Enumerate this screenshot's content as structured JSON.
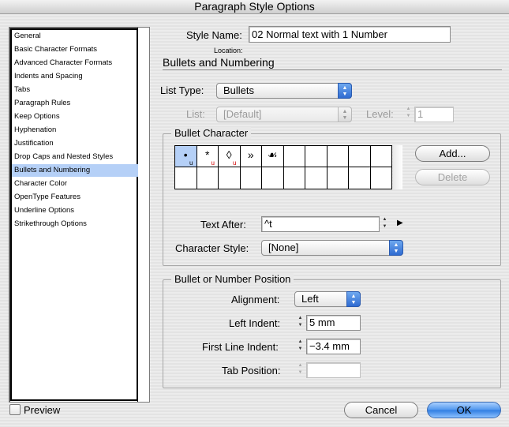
{
  "window": {
    "title": "Paragraph Style Options"
  },
  "sidebar": {
    "items": [
      {
        "label": "General"
      },
      {
        "label": "Basic Character Formats"
      },
      {
        "label": "Advanced Character Formats"
      },
      {
        "label": "Indents and Spacing"
      },
      {
        "label": "Tabs"
      },
      {
        "label": "Paragraph Rules"
      },
      {
        "label": "Keep Options"
      },
      {
        "label": "Hyphenation"
      },
      {
        "label": "Justification"
      },
      {
        "label": "Drop Caps and Nested Styles"
      },
      {
        "label": "Bullets and Numbering"
      },
      {
        "label": "Character Color"
      },
      {
        "label": "OpenType Features"
      },
      {
        "label": "Underline Options"
      },
      {
        "label": "Strikethrough Options"
      }
    ],
    "selected": "Bullets and Numbering"
  },
  "header": {
    "style_name_label": "Style Name:",
    "style_name_value": "02 Normal text with 1 Number",
    "location_label": "Location:",
    "section_title": "Bullets and Numbering"
  },
  "list": {
    "type_label": "List Type:",
    "type_value": "Bullets",
    "list_label": "List:",
    "list_value": "[Default]",
    "level_label": "Level:",
    "level_value": "1"
  },
  "bullet_character": {
    "group_title": "Bullet Character",
    "glyphs": [
      "•",
      "*",
      "◊",
      "»",
      "☙"
    ],
    "glyph_font_marks": [
      "u",
      "u",
      "u",
      "",
      ""
    ],
    "add_label": "Add...",
    "delete_label": "Delete",
    "text_after_label": "Text After:",
    "text_after_value": "^t",
    "char_style_label": "Character Style:",
    "char_style_value": "[None]"
  },
  "position": {
    "group_title": "Bullet or Number Position",
    "alignment_label": "Alignment:",
    "alignment_value": "Left",
    "left_indent_label": "Left Indent:",
    "left_indent_value": "5 mm",
    "first_line_label": "First Line Indent:",
    "first_line_value": "−3.4 mm",
    "tab_position_label": "Tab Position:",
    "tab_position_value": ""
  },
  "footer": {
    "preview_label": "Preview",
    "cancel_label": "Cancel",
    "ok_label": "OK"
  }
}
